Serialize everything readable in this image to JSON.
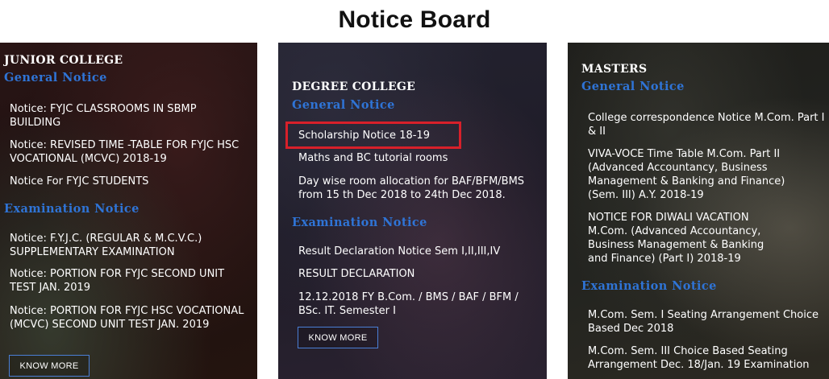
{
  "page_title": "Notice Board",
  "junior": {
    "heading": "JUNIOR COLLEGE",
    "general_heading": "General Notice",
    "general_notices": [
      "Notice: FYJC CLASSROOMS IN SBMP BUILDING",
      "Notice: REVISED TIME -TABLE FOR FYJC HSC VOCATIONAL (MCVC) 2018-19",
      "Notice For FYJC STUDENTS"
    ],
    "exam_heading": "Examination Notice",
    "exam_notices": [
      "Notice: F.Y.J.C. (REGULAR & M.C.V.C.) SUPPLEMENTARY EXAMINATION",
      "Notice: PORTION FOR FYJC SECOND UNIT TEST JAN. 2019",
      "Notice: PORTION FOR FYJC HSC VOCATIONAL (MCVC) SECOND UNIT TEST JAN. 2019"
    ],
    "button": "KNOW MORE"
  },
  "degree": {
    "heading": "DEGREE COLLEGE",
    "general_heading": "General Notice",
    "general_notices": [
      "Scholarship Notice 18-19",
      "Maths and BC tutorial rooms",
      "Day wise room allocation for BAF/BFM/BMS from 15 th Dec 2018 to 24th Dec 2018."
    ],
    "exam_heading": "Examination Notice",
    "exam_notices": [
      "Result Declaration Notice Sem I,II,III,IV",
      "RESULT DECLARATION",
      "12.12.2018 FY B.Com. / BMS / BAF / BFM / BSc. IT. Semester I"
    ],
    "button": "KNOW MORE"
  },
  "masters": {
    "heading": "MASTERS",
    "general_heading": "General Notice",
    "general_notices": [
      "College correspondence Notice M.Com. Part I & II",
      "VIVA-VOCE Time Table M.Com. Part II (Advanced Accountancy, Business Management & Banking and Finance) (Sem. III) A.Y. 2018-19",
      "NOTICE FOR DIWALI VACATION M.Com. (Advanced Accountancy, Business Management & Banking and Finance) (Part I) 2018-19"
    ],
    "exam_heading": "Examination Notice",
    "exam_notices": [
      "M.Com. Sem. I Seating Arrangement Choice Based Dec 2018",
      "M.Com. Sem. III Choice Based Seating Arrangement Dec. 18/Jan. 19 Examination"
    ]
  },
  "colors": {
    "accent_blue": "#2f74d6",
    "highlight_red": "#d8202a",
    "title_text": "#111111"
  }
}
